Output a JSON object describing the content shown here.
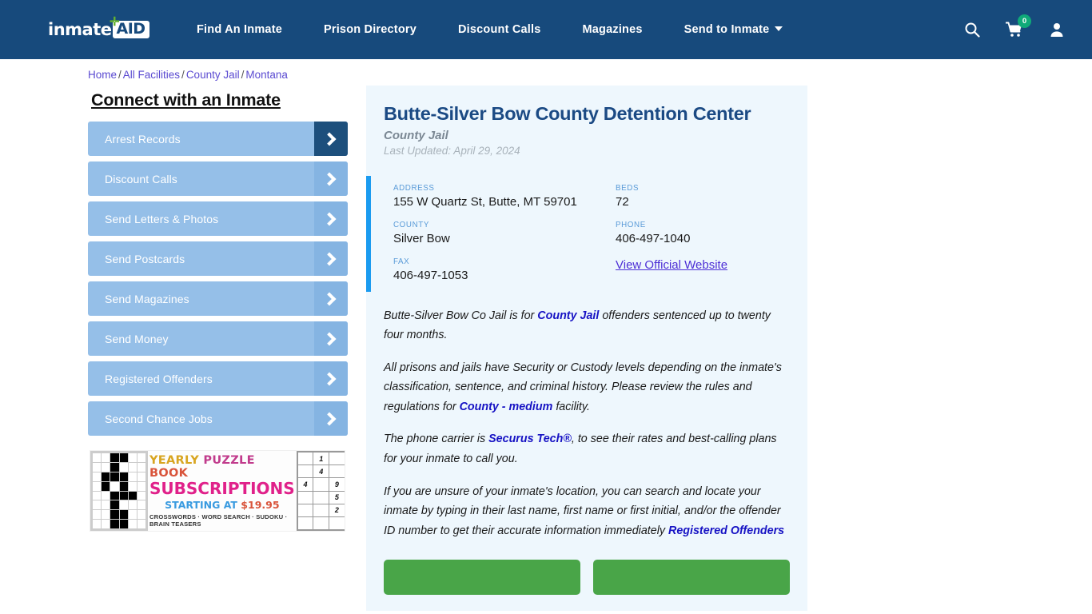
{
  "brand": {
    "logo_word": "inmate",
    "logo_plus": "✛",
    "logo_box": "AID",
    "header_bg": "#174a7c",
    "accent_blue": "#1b9bf0",
    "cart_badge_bg": "#0faa79",
    "cta_green": "#49a548"
  },
  "nav": {
    "items": [
      {
        "label": "Find An Inmate"
      },
      {
        "label": "Prison Directory"
      },
      {
        "label": "Discount Calls"
      },
      {
        "label": "Magazines"
      },
      {
        "label": "Send to Inmate",
        "has_caret": true
      }
    ],
    "icons": {
      "search": "search-icon",
      "cart": "cart-icon",
      "account": "user-icon"
    },
    "cart_count": "0"
  },
  "breadcrumb": {
    "items": [
      "Home",
      "All Facilities",
      "County Jail",
      "Montana"
    ],
    "separator": "/"
  },
  "sidebar": {
    "title": "Connect with an Inmate",
    "items": [
      {
        "label": "Arrest Records",
        "active": true
      },
      {
        "label": "Discount Calls",
        "active": false
      },
      {
        "label": "Send Letters & Photos",
        "active": false
      },
      {
        "label": "Send Postcards",
        "active": false
      },
      {
        "label": "Send Magazines",
        "active": false
      },
      {
        "label": "Send Money",
        "active": false
      },
      {
        "label": "Registered Offenders",
        "active": false
      },
      {
        "label": "Second Chance Jobs",
        "active": false
      }
    ]
  },
  "ad": {
    "line1_a": "YEARLY ",
    "line1_b": "PUZZLE ",
    "line1_c": "BOOK",
    "line2": "SUBSCRIPTIONS",
    "line3_a": "STARTING AT ",
    "line3_b": "$19.95",
    "line4": "CROSSWORDS · WORD SEARCH · SUDOKU · BRAIN TEASERS",
    "sudoku_digits": [
      "",
      "1",
      "",
      "",
      "4",
      "",
      "4",
      "",
      "9",
      "",
      "",
      "5",
      "",
      "",
      "2",
      "",
      "",
      ""
    ]
  },
  "facility": {
    "name": "Butte-Silver Bow County Detention Center",
    "type": "County Jail",
    "last_updated": "Last Updated: April 29, 2024",
    "fields": [
      {
        "label": "ADDRESS",
        "value": "155 W Quartz St, Butte, MT 59701"
      },
      {
        "label": "BEDS",
        "value": "72"
      },
      {
        "label": "COUNTY",
        "value": "Silver Bow"
      },
      {
        "label": "PHONE",
        "value": "406-497-1040"
      },
      {
        "label": "FAX",
        "value": "406-497-1053"
      },
      {
        "label": "",
        "value": "",
        "link_text": "View Official Website"
      }
    ]
  },
  "content": {
    "p1_a": "Butte-Silver Bow Co Jail is for ",
    "p1_hl": "County Jail",
    "p1_b": " offenders sentenced up to twenty four months.",
    "p2_a": "All prisons and jails have Security or Custody levels depending on the inmate's classification, sentence, and criminal history. Please review the rules and regulations for ",
    "p2_hl": "County - medium",
    "p2_b": " facility.",
    "p3_a": "The phone carrier is ",
    "p3_hl": "Securus Tech®",
    "p3_b": ", to see their rates and best-calling plans for your inmate to call you.",
    "p4_a": "If you are unsure of your inmate's location, you can search and locate your inmate by typing in their last name, first name or first initial, and/or the offender ID number to get their accurate information immediately ",
    "p4_hl": "Registered Offenders"
  },
  "cta": {
    "left_label": "",
    "right_label": ""
  }
}
